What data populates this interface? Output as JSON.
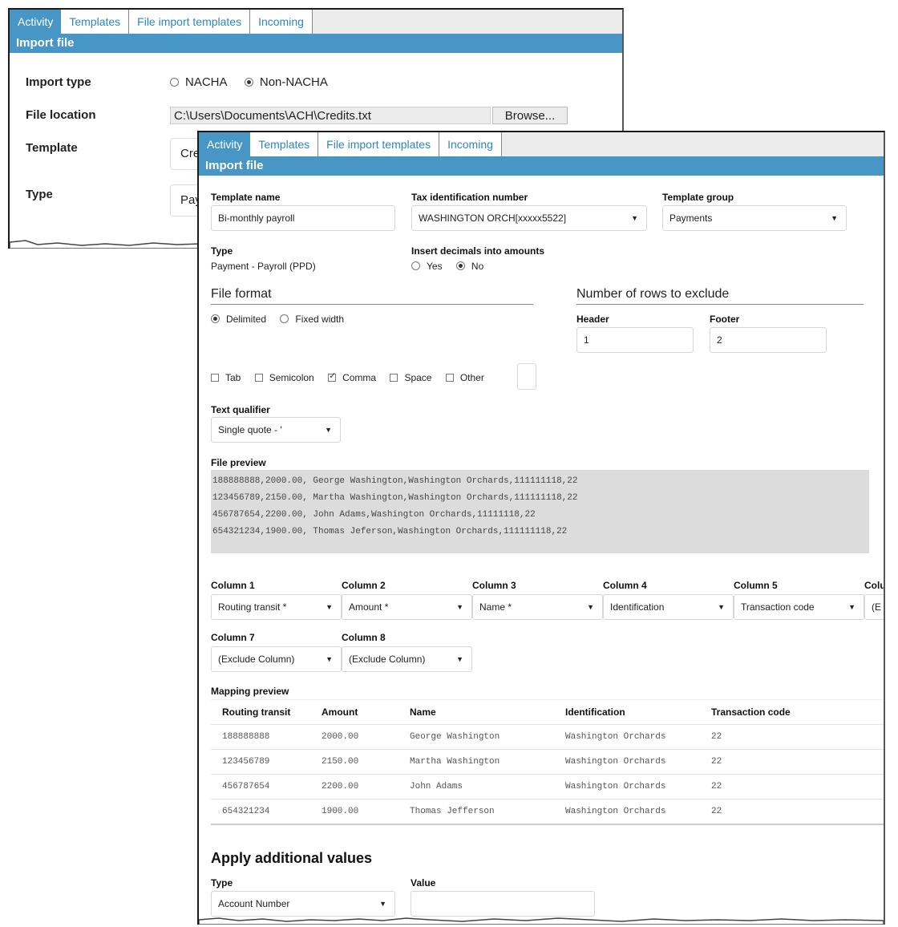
{
  "back_window": {
    "tabs": [
      {
        "label": "Activity",
        "active": true
      },
      {
        "label": "Templates",
        "active": false
      },
      {
        "label": "File import templates",
        "active": false
      },
      {
        "label": "Incoming",
        "active": false
      }
    ],
    "section_title": "Import file",
    "import_type": {
      "label": "Import type",
      "options": [
        {
          "label": "NACHA",
          "selected": false
        },
        {
          "label": "Non-NACHA",
          "selected": true
        }
      ]
    },
    "file_location": {
      "label": "File location",
      "value": "C:\\Users\\Documents\\ACH\\Credits.txt",
      "browse_label": "Browse..."
    },
    "template": {
      "label": "Template",
      "value": "Cre"
    },
    "type": {
      "label": "Type",
      "value": "Pay"
    }
  },
  "front_window": {
    "tabs": [
      {
        "label": "Activity",
        "active": true
      },
      {
        "label": "Templates",
        "active": false
      },
      {
        "label": "File import templates",
        "active": false
      },
      {
        "label": "Incoming",
        "active": false
      }
    ],
    "section_title": "Import file",
    "template_name": {
      "label": "Template name",
      "value": "Bi-monthly payroll"
    },
    "tax_id": {
      "label": "Tax identification number",
      "value": "WASHINGTON ORCH[xxxxx5522]"
    },
    "template_group": {
      "label": "Template group",
      "value": "Payments"
    },
    "type": {
      "label": "Type",
      "value": "Payment - Payroll (PPD)"
    },
    "insert_decimals": {
      "label": "Insert decimals into amounts",
      "options": [
        {
          "label": "Yes",
          "selected": false
        },
        {
          "label": "No",
          "selected": true
        }
      ]
    },
    "file_format": {
      "heading": "File format",
      "options": [
        {
          "label": "Delimited",
          "selected": true
        },
        {
          "label": "Fixed width",
          "selected": false
        }
      ],
      "delimiters": [
        {
          "label": "Tab",
          "checked": false
        },
        {
          "label": "Semicolon",
          "checked": false
        },
        {
          "label": "Comma",
          "checked": true
        },
        {
          "label": "Space",
          "checked": false
        },
        {
          "label": "Other",
          "checked": false
        }
      ],
      "other_value": ""
    },
    "rows_to_exclude": {
      "heading": "Number of rows to exclude",
      "header_label": "Header",
      "header_value": "1",
      "footer_label": "Footer",
      "footer_value": "2"
    },
    "text_qualifier": {
      "label": "Text qualifier",
      "value": "Single quote - '"
    },
    "file_preview": {
      "label": "File preview",
      "lines": [
        "188888888,2000.00, George Washington,Washington Orchards,111111118,22",
        "123456789,2150.00, Martha Washington,Washington Orchards,111111118,22",
        "456787654,2200.00, John Adams,Washington Orchards,11111118,22",
        "654321234,1900.00, Thomas Jeferson,Washington Orchards,111111118,22"
      ]
    },
    "columns": [
      {
        "label": "Column 1",
        "value": "Routing transit *"
      },
      {
        "label": "Column 2",
        "value": "Amount *"
      },
      {
        "label": "Column 3",
        "value": "Name *"
      },
      {
        "label": "Column 4",
        "value": "Identification"
      },
      {
        "label": "Column 5",
        "value": "Transaction code"
      },
      {
        "label": "Colu",
        "value": "(E"
      },
      {
        "label": "Column 7",
        "value": "(Exclude Column)"
      },
      {
        "label": "Column 8",
        "value": "(Exclude Column)"
      }
    ],
    "mapping_preview": {
      "label": "Mapping preview",
      "headers": [
        "Routing transit",
        "Amount",
        "Name",
        "Identification",
        "Transaction code"
      ],
      "rows": [
        [
          "188888888",
          "2000.00",
          "George Washington",
          "Washington Orchards",
          "22"
        ],
        [
          "123456789",
          "2150.00",
          "Martha Washington",
          "Washington Orchards",
          "22"
        ],
        [
          "456787654",
          "2200.00",
          "John Adams",
          "Washington Orchards",
          "22"
        ],
        [
          "654321234",
          "1900.00",
          "Thomas Jefferson",
          "Washington Orchards",
          "22"
        ]
      ]
    },
    "additional_values": {
      "heading": "Apply additional values",
      "type_label": "Type",
      "type_value": "Account Number",
      "value_label": "Value",
      "value_value": ""
    }
  },
  "icons": {
    "dropdown": "▼"
  }
}
